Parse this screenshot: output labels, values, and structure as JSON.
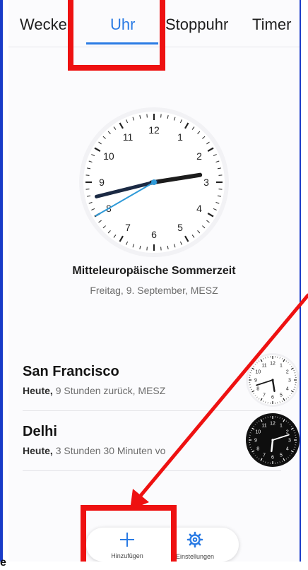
{
  "tabs": [
    {
      "label": "Wecker"
    },
    {
      "label": "Uhr"
    },
    {
      "label": "Stoppuhr"
    },
    {
      "label": "Timer"
    }
  ],
  "home_clock": {
    "timezone": "Mitteleuropäische Sommerzeit",
    "date_line": "Freitag, 9. September, MESZ",
    "time": "14:42:40",
    "numerals": [
      "12",
      "1",
      "2",
      "3",
      "4",
      "5",
      "6",
      "7",
      "8",
      "9",
      "10",
      "11"
    ]
  },
  "world_clocks": [
    {
      "city": "San Francisco",
      "day": "Heute,",
      "offset": "9 Stunden zurück, MESZ",
      "time": "05:42",
      "face": "light"
    },
    {
      "city": "Delhi",
      "day": "Heute,",
      "offset": "3 Stunden 30 Minuten vo",
      "time": "18:12",
      "face": "dark"
    }
  ],
  "actions": {
    "add_label": "Hinzufügen",
    "settings_label": "Einstellungen"
  },
  "edge_fragment": "e",
  "colors": {
    "accent": "#2a7be4",
    "annotation": "#ee1111"
  }
}
